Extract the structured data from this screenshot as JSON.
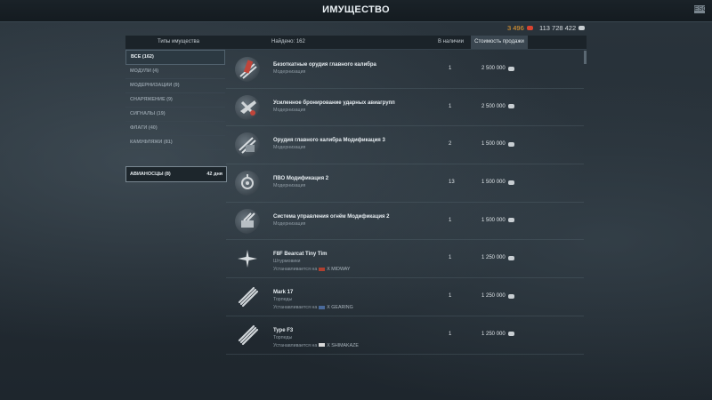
{
  "window": {
    "title": "ИМУЩЕСТВО",
    "close_label": "ESC"
  },
  "currency": {
    "doubloons": "3 496",
    "credits": "113 728 422"
  },
  "header": {
    "types_label": "Типы имущества",
    "found_label": "Найдено: 162",
    "available_label": "В наличии",
    "sale_label": "Стоимость продажи"
  },
  "categories": [
    {
      "label": "ВСЕ (162)",
      "active": true
    },
    {
      "label": "МОДУЛИ (4)",
      "active": false
    },
    {
      "label": "МОДЕРНИЗАЦИИ (9)",
      "active": false
    },
    {
      "label": "СНАРЯЖЕНИЕ (9)",
      "active": false
    },
    {
      "label": "СИГНАЛЫ (19)",
      "active": false
    },
    {
      "label": "ФЛАГИ (40)",
      "active": false
    },
    {
      "label": "КАМУФЛЯЖИ (81)",
      "active": false
    }
  ],
  "carriers": {
    "label": "АВИАНОСЦЫ (8)",
    "days": "42 дня"
  },
  "items": [
    {
      "name": "Безоткатные орудия главного калибра",
      "type": "Модернизация",
      "qty": "1",
      "price": "2 500 000",
      "icon": "guns-icon"
    },
    {
      "name": "Усиленное бронирование ударных авиагрупп",
      "type": "Модернизация",
      "qty": "1",
      "price": "2 500 000",
      "icon": "aircraft-armor-icon"
    },
    {
      "name": "Орудия главного калибра Модификация 3",
      "type": "Модернизация",
      "qty": "2",
      "price": "1 500 000",
      "icon": "guns-icon"
    },
    {
      "name": "ПВО Модификация 2",
      "type": "Модернизация",
      "qty": "13",
      "price": "1 500 000",
      "icon": "aa-icon"
    },
    {
      "name": "Система управления огнём Модификация 2",
      "type": "Модернизация",
      "qty": "1",
      "price": "1 500 000",
      "icon": "fire-control-icon"
    },
    {
      "name": "F8F Bearcat Tiny Tim",
      "type": "Штурмовики",
      "qty": "1",
      "price": "1 250 000",
      "installed": "Устанавливается на",
      "ship": "X MIDWAY",
      "icon": "plane-icon"
    },
    {
      "name": "Mark 17",
      "type": "Торпеды",
      "qty": "1",
      "price": "1 250 000",
      "installed": "Устанавливается на",
      "ship": "X GEARING",
      "icon": "torpedo-icon"
    },
    {
      "name": "Type F3",
      "type": "Торпеды",
      "qty": "1",
      "price": "1 250 000",
      "installed": "Устанавливается на",
      "ship": "X SHIMAKAZE",
      "icon": "torpedo-icon"
    }
  ]
}
